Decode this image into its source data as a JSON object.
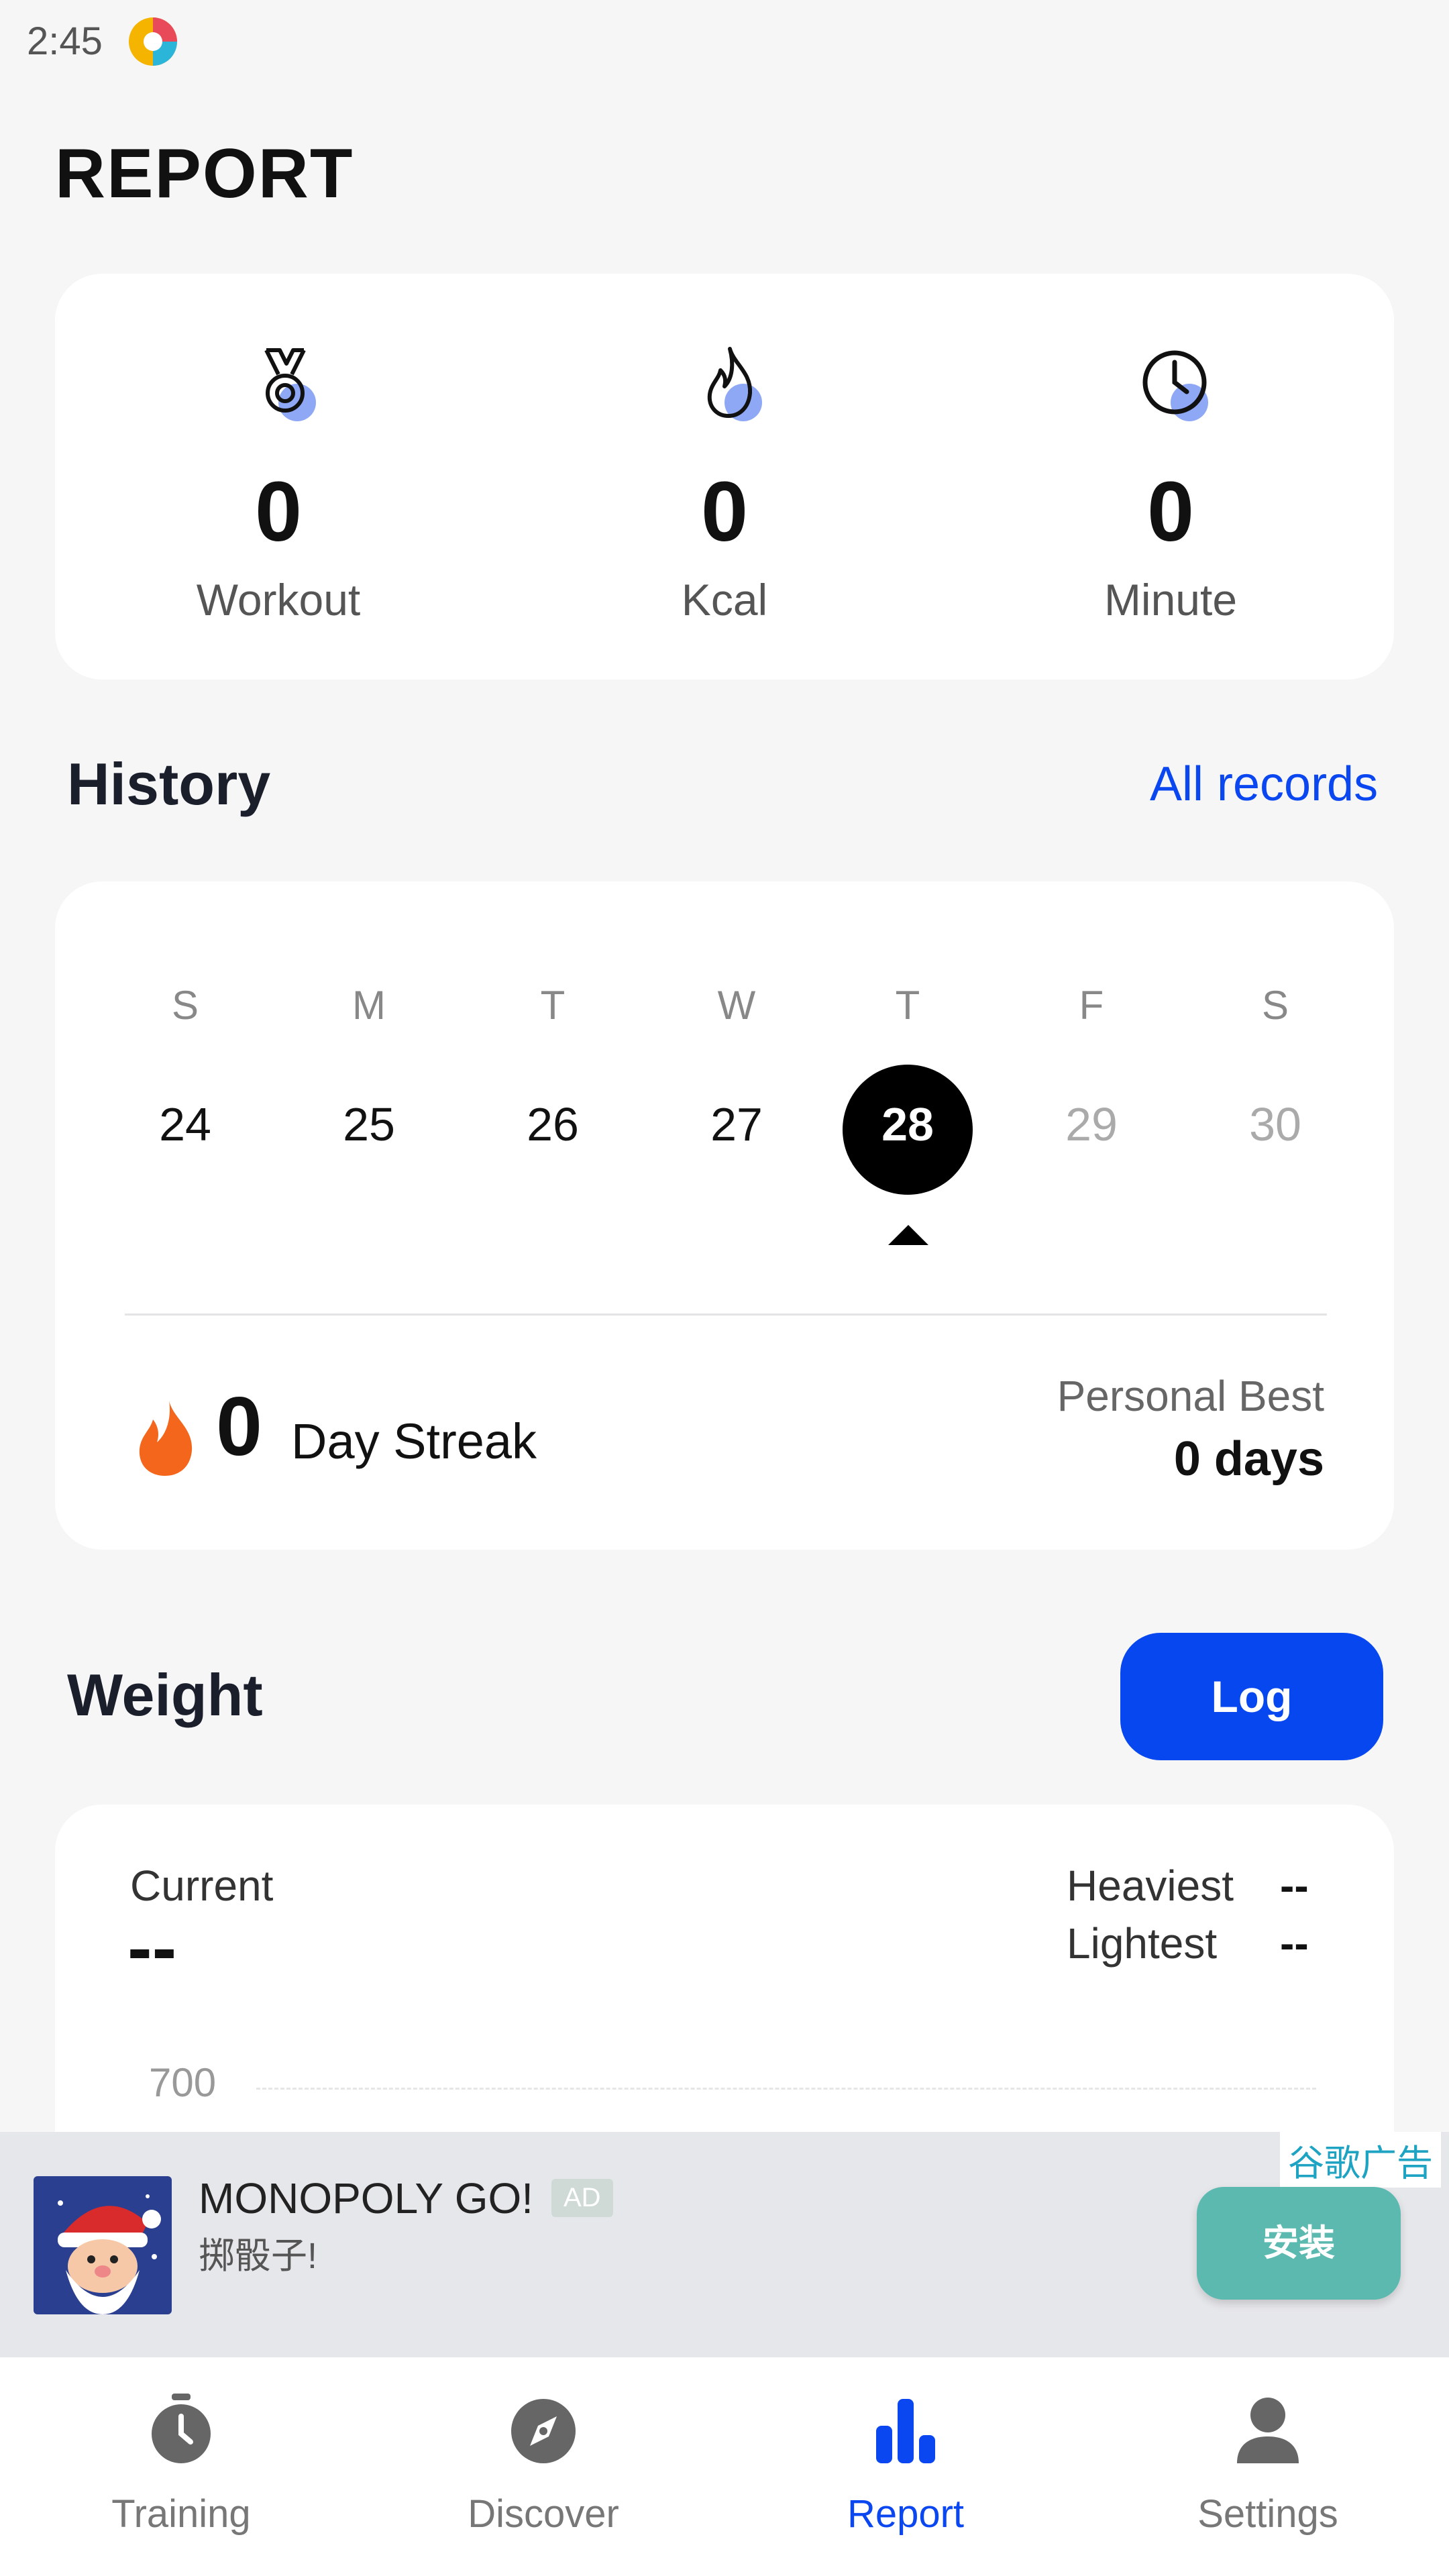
{
  "status_bar": {
    "time": "2:45"
  },
  "header": {
    "title": "REPORT"
  },
  "summary": {
    "stats": [
      {
        "icon": "medal-icon",
        "value": "0",
        "label": "Workout"
      },
      {
        "icon": "flame-icon",
        "value": "0",
        "label": "Kcal"
      },
      {
        "icon": "clock-icon",
        "value": "0",
        "label": "Minute"
      }
    ]
  },
  "history": {
    "title": "History",
    "all_records_link": "All records",
    "weekdays": [
      "S",
      "M",
      "T",
      "W",
      "T",
      "F",
      "S"
    ],
    "days": [
      "24",
      "25",
      "26",
      "27",
      "28",
      "29",
      "30"
    ],
    "selected_day": "28",
    "streak": {
      "value": "0",
      "label": "Day Streak"
    },
    "personal_best": {
      "label": "Personal Best",
      "value": "0 days"
    }
  },
  "weight": {
    "title": "Weight",
    "log_button": "Log",
    "current_label": "Current",
    "current_value": "--",
    "heaviest_label": "Heaviest",
    "heaviest_value": "--",
    "lightest_label": "Lightest",
    "lightest_value": "--",
    "y_tick": "700"
  },
  "ad": {
    "tag": "谷歌广告",
    "title": "MONOPOLY GO!",
    "badge": "AD",
    "subtitle": "掷骰子!",
    "install_button": "安装"
  },
  "bottom_nav": {
    "items": [
      {
        "label": "Training",
        "icon": "stopwatch-icon"
      },
      {
        "label": "Discover",
        "icon": "compass-icon"
      },
      {
        "label": "Report",
        "icon": "bar-chart-icon",
        "active": true
      },
      {
        "label": "Settings",
        "icon": "person-icon"
      }
    ]
  },
  "colors": {
    "accent": "#0747ef",
    "streak": "#f4661b",
    "install": "#5cb9b0"
  }
}
